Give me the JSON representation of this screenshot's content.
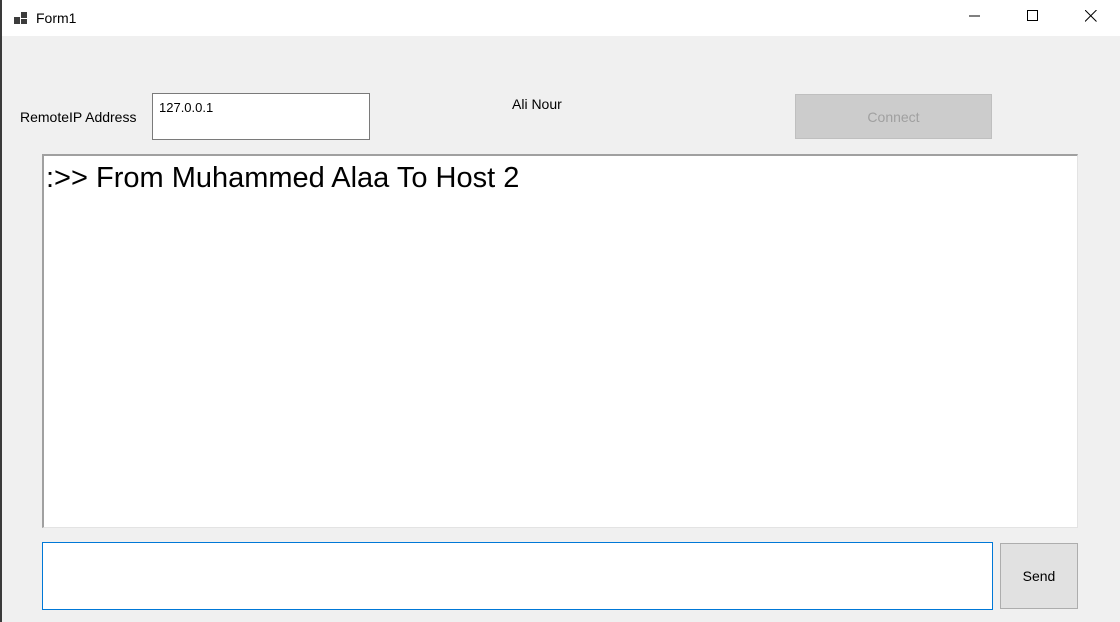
{
  "window": {
    "title": "Form1",
    "app_icon": "windows-forms-app-icon",
    "controls": {
      "minimize_icon": "minimize-icon",
      "maximize_icon": "maximize-icon",
      "close_icon": "close-icon"
    }
  },
  "connection": {
    "ip_label": "RemoteIP Address",
    "ip_value": "127.0.0.1",
    "user_name": "Ali Nour",
    "connect_label": "Connect",
    "connect_enabled": false
  },
  "chat": {
    "lines": [
      ":>> From Muhammed Alaa To Host 2"
    ]
  },
  "compose": {
    "message_value": "",
    "send_label": "Send"
  },
  "colors": {
    "focus_border": "#0078d7",
    "form_background": "#f0f0f0",
    "disabled_button": "#cccccc"
  }
}
